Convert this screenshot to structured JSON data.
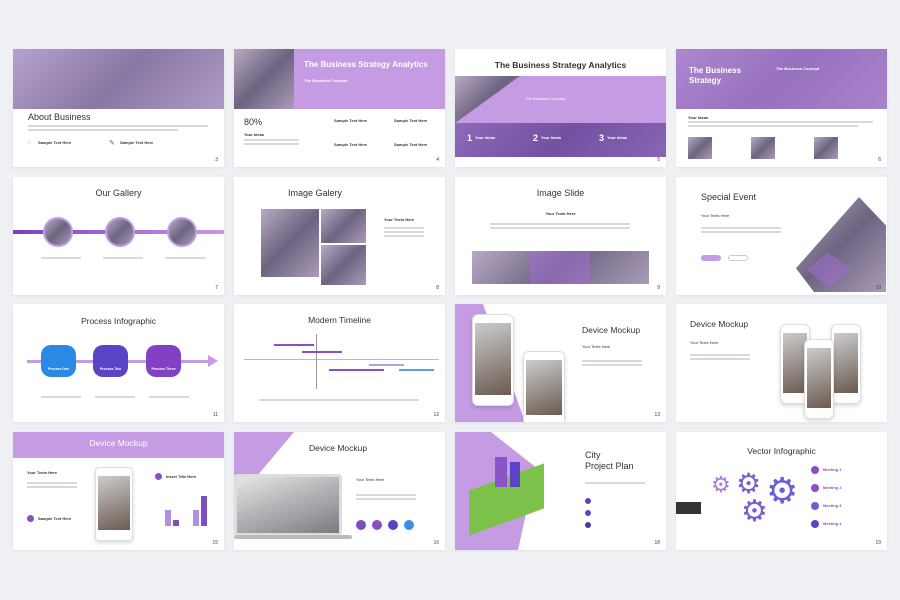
{
  "colors": {
    "accent": "#c59be3",
    "dark_purple": "#6a3fb5",
    "blue": "#3a8ee6",
    "background": "#eef0f4"
  },
  "slides": [
    {
      "title": "About Business",
      "number": "3",
      "items": [
        "Sample Text Here",
        "Sample Text Here"
      ]
    },
    {
      "title": "The Business Strategy Analytics",
      "subtitle": "The Business Concept",
      "stat": "80%",
      "stat_label": "Your Ideas",
      "items": [
        "Sample Text Here",
        "Sample Text Here",
        "Sample Text Here",
        "Sample Text Here"
      ],
      "number": "4"
    },
    {
      "title": "The Business Strategy Analytics",
      "subtitle": "The Business Concept",
      "steps": [
        "Your Ideas",
        "Your Ideas",
        "Your Ideas"
      ],
      "step_numbers": [
        "1",
        "2",
        "3"
      ],
      "number": "5"
    },
    {
      "title": "The Business Strategy",
      "subtitle": "The Business Concept",
      "section": "Your Ideas",
      "number": "6"
    },
    {
      "title": "Our Gallery",
      "number": "7"
    },
    {
      "title": "Image Galery",
      "text_heading": "Your Texts Here",
      "number": "8"
    },
    {
      "title": "Image Slide",
      "text_heading": "Your Texts Here",
      "number": "9"
    },
    {
      "title": "Special Event",
      "text_heading": "Your Texts Here",
      "number": "10"
    },
    {
      "title": "Process Infographic",
      "steps": [
        "Process One",
        "Process Two",
        "Process Three"
      ],
      "number": "11"
    },
    {
      "title": "Modern Timeline",
      "number": "12"
    },
    {
      "title": "Device Mockup",
      "text_heading": "Your Texts Here",
      "number": "13"
    },
    {
      "title": "Device Mockup",
      "text_heading": "Your Texts Here"
    },
    {
      "title": "Device Mockup",
      "text_heading": "Your Texts Here",
      "chart_title": "Insert Title Here",
      "item": "Sample Text Here",
      "number": "15"
    },
    {
      "title": "Device Mockup",
      "text_heading": "Your Texts Here",
      "number": "16"
    },
    {
      "title": "City",
      "title2": "Project Plan",
      "number": "18"
    },
    {
      "title": "Vector Infographic",
      "items": [
        "Meeting 1",
        "Meeting 2",
        "Meeting 3",
        "Meeting 4"
      ],
      "number": "19"
    }
  ]
}
